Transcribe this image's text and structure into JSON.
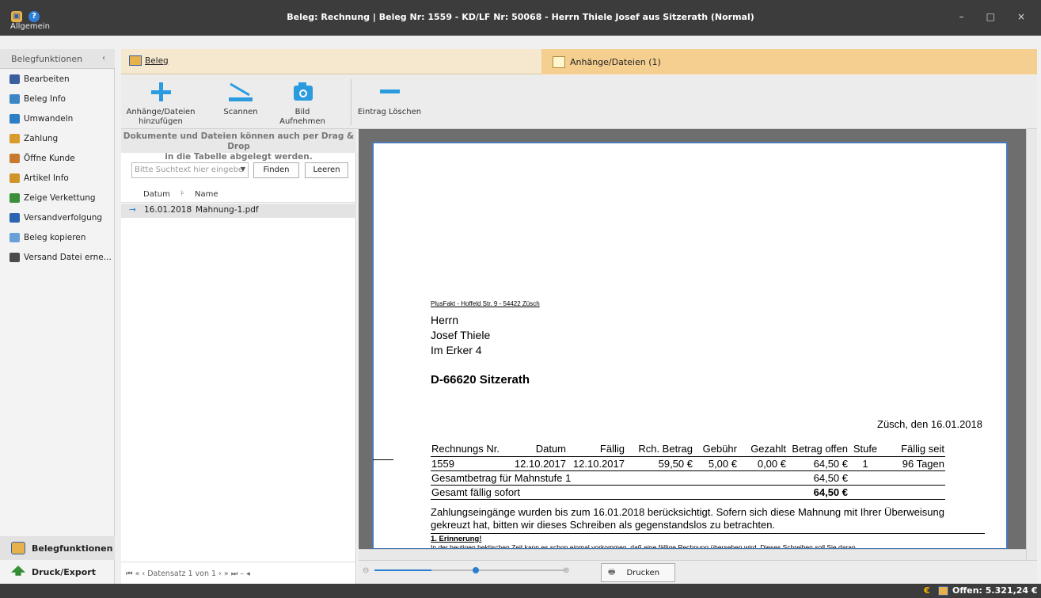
{
  "window": {
    "title": "Beleg: Rechnung | Beleg Nr: 1559 -  KD/LF Nr: 50068 - Herrn Thiele Josef aus Sitzerath (Normal)",
    "menu": "Allgemein",
    "controls": {
      "minimize": "–",
      "maximize": "□",
      "close": "×"
    }
  },
  "sidebar": {
    "header": "Belegfunktionen",
    "collapse_glyph": "‹",
    "items": [
      {
        "label": "Bearbeiten",
        "icon": "pencil-icon",
        "color": "#3a5fa0"
      },
      {
        "label": "Beleg Info",
        "icon": "info-icon",
        "color": "#3d86c6"
      },
      {
        "label": "Umwandeln",
        "icon": "convert-icon",
        "color": "#2c7fc4"
      },
      {
        "label": "Zahlung",
        "icon": "payment-icon",
        "color": "#d89b2e"
      },
      {
        "label": "Öffne Kunde",
        "icon": "customer-icon",
        "color": "#c77a2d"
      },
      {
        "label": "Artikel Info",
        "icon": "article-icon",
        "color": "#d0942a"
      },
      {
        "label": "Zeige Verkettung",
        "icon": "chain-icon",
        "color": "#3b8f3b"
      },
      {
        "label": "Versandverfolgung",
        "icon": "truck-icon",
        "color": "#2d64b0"
      },
      {
        "label": "Beleg kopieren",
        "icon": "copy-icon",
        "color": "#6aa0d8"
      },
      {
        "label": "Versand Datei erne...",
        "icon": "pallet-icon",
        "color": "#4a4a4a"
      }
    ],
    "bottom": {
      "belegfunktionen": "Belegfunktionen",
      "druck": "Druck/Export"
    }
  },
  "tabs": {
    "beleg": "Beleg",
    "anhaenge": "Anhänge/Dateien (1)"
  },
  "toolbar": {
    "add_line1": "Anhänge/Dateien",
    "add_line2": "hinzufügen",
    "scan": "Scannen",
    "photo": "Bild Aufnehmen",
    "delete": "Eintrag Löschen"
  },
  "filepanel": {
    "hint_line1": "Dokumente und Dateien können auch per Drag & Drop",
    "hint_line2": "in die Tabelle abgelegt werden.",
    "search_placeholder": "Bitte Suchtext hier eingebe",
    "find": "Finden",
    "clear": "Leeren",
    "columns": {
      "date": "Datum",
      "name": "Name"
    },
    "rows": [
      {
        "date": "16.01.2018",
        "name": "Mahnung-1.pdf"
      }
    ],
    "nav": "⏮  «  ‹  Datensatz 1 von 1  ›  »  ⏭  –  ◂"
  },
  "document": {
    "sender": "PlusFakt - Hoffeld Str. 9 - 54422 Züsch",
    "addr1": "Herrn",
    "addr2": "Josef Thiele",
    "addr3": "Im Erker 4",
    "city": "D-66620 Sitzerath",
    "place_date": "Züsch, den 16.01.2018",
    "table_headers": [
      "Rechnungs Nr.",
      "Datum",
      "Fällig",
      "Rch. Betrag",
      "Gebühr",
      "Gezahlt",
      "Betrag offen",
      "Stufe",
      "Fällig seit"
    ],
    "row": [
      "1559",
      "12.10.2017",
      "12.10.2017",
      "59,50 €",
      "5,00 €",
      "0,00 €",
      "64,50 €",
      "1",
      "96 Tagen"
    ],
    "subtotal_label": "Gesamtbetrag für Mahnstufe 1",
    "subtotal_value": "64,50 €",
    "total_label": "Gesamt fällig sofort",
    "total_value": "64,50 €",
    "note1": "Zahlungseingänge wurden bis zum 16.01.2018 berücksichtigt. Sofern sich diese Mahnung mit Ihrer Überweisung",
    "note2": "gekreuzt hat, bitten wir dieses Schreiben als gegenstandslos zu betrachten.",
    "reminder_title": "1. Erinnerung!",
    "reminder_text": "In der heutigen hektischen Zeit kann es schon einmal vorkommen, daß eine fällige Rechnung übersehen wird. Dieses Schreiben soll Sie daran"
  },
  "zoom": {
    "print": "Drucken",
    "level": 0.3
  },
  "status": {
    "offen": "Offen: 5.321,24 €",
    "currency": "€"
  }
}
